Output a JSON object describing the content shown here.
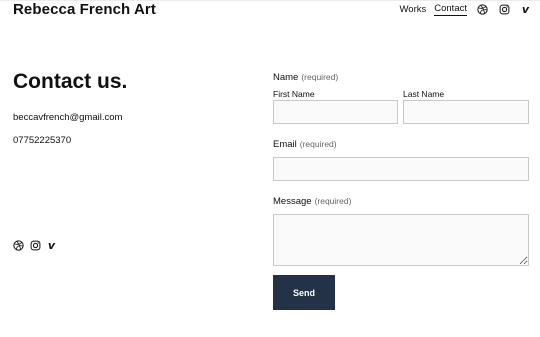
{
  "site": {
    "title": "Rebecca French Art"
  },
  "nav": {
    "links": [
      "Works",
      "Contact"
    ],
    "active": "Contact",
    "icons": [
      "dribbble-icon",
      "instagram-icon",
      "vimeo-icon"
    ]
  },
  "contact": {
    "heading": "Contact us.",
    "email": "beccavfrench@gmail.com",
    "phone": "07752225370"
  },
  "social_icons": [
    "dribbble-icon",
    "instagram-icon",
    "vimeo-icon"
  ],
  "form": {
    "name_label": "Name",
    "required_text": "(required)",
    "first_name_label": "First Name",
    "last_name_label": "Last Name",
    "email_label": "Email",
    "message_label": "Message",
    "submit_label": "Send"
  },
  "colors": {
    "button": "#243247",
    "field_border": "#c8c8c8",
    "field_bg": "#fafafa"
  }
}
